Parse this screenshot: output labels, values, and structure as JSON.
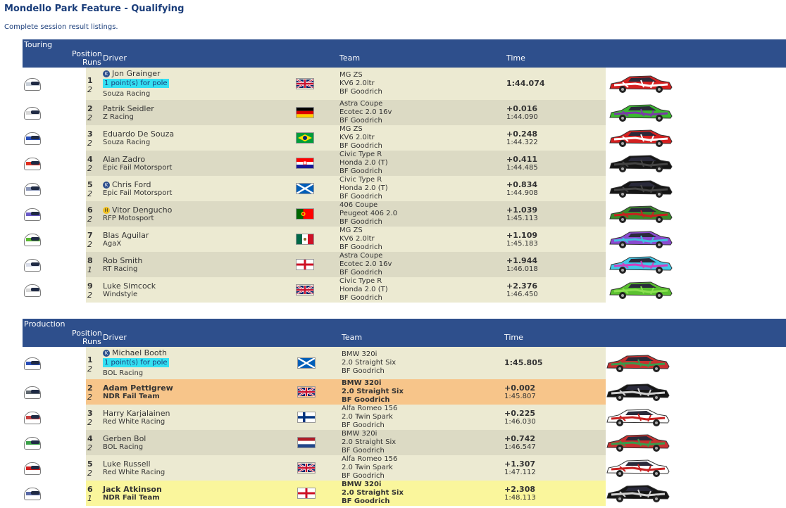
{
  "page": {
    "title": "Mondello Park Feature - Qualifying",
    "subtitle": "Complete session result listings."
  },
  "sections": [
    {
      "name": "Touring",
      "header": {
        "position": "Position",
        "runs": "Runs",
        "driver": "Driver",
        "team": "Team",
        "time": "Time"
      },
      "rows": [
        {
          "pos": "1",
          "runs": "2",
          "badge": "K",
          "driver": "Jon Grainger",
          "pole": "1 point(s) for pole",
          "team": "Souza Racing",
          "flag": "uk",
          "car": [
            "MG ZS",
            "KV6 2.0ltr",
            "BF Goodrich"
          ],
          "time_main": "1:44.074",
          "time_sub": "",
          "helmet": "#c8cfd8",
          "livery": "#d42020",
          "livery2": "#ffffff"
        },
        {
          "pos": "2",
          "runs": "2",
          "badge": "",
          "driver": "Patrik Seidler",
          "pole": "",
          "team": "Z Racing",
          "flag": "germany",
          "car": [
            "Astra Coupe",
            "Ecotec 2.0 16v",
            "BF Goodrich"
          ],
          "time_main": "+0.016",
          "time_sub": "1:44.090",
          "helmet": "#d8d8d8",
          "livery": "#3bb830",
          "livery2": "#7a3aa8"
        },
        {
          "pos": "3",
          "runs": "2",
          "badge": "",
          "driver": "Eduardo De Souza",
          "pole": "",
          "team": "Souza Racing",
          "flag": "brazil",
          "car": [
            "MG ZS",
            "KV6 2.0ltr",
            "BF Goodrich"
          ],
          "time_main": "+0.248",
          "time_sub": "1:44.322",
          "helmet": "#2a4fb8",
          "livery": "#d42020",
          "livery2": "#ffffff"
        },
        {
          "pos": "4",
          "runs": "2",
          "badge": "",
          "driver": "Alan Zadro",
          "pole": "",
          "team": "Epic Fail Motorsport",
          "flag": "croatia",
          "car": [
            "Civic Type R",
            "Honda 2.0 (T)",
            "BF Goodrich"
          ],
          "time_main": "+0.411",
          "time_sub": "1:44.485",
          "helmet": "#e03020",
          "livery": "#151515",
          "livery2": "#444444"
        },
        {
          "pos": "5",
          "runs": "2",
          "badge": "K",
          "driver": "Chris Ford",
          "pole": "",
          "team": "Epic Fail Motorsport",
          "flag": "scotland",
          "car": [
            "Civic Type R",
            "Honda 2.0 (T)",
            "BF Goodrich"
          ],
          "time_main": "+0.834",
          "time_sub": "1:44.908",
          "helmet": "#8a96b8",
          "livery": "#151515",
          "livery2": "#444444"
        },
        {
          "pos": "6",
          "runs": "2",
          "badge": "H",
          "driver": "Vitor Dengucho",
          "pole": "",
          "team": "RFP Motosport",
          "flag": "portugal",
          "car": [
            "406 Coupe",
            "Peugeot 406 2.0",
            "BF Goodrich"
          ],
          "time_main": "+1.039",
          "time_sub": "1:45.113",
          "helmet": "#6a5ac8",
          "livery": "#3a8a2a",
          "livery2": "#c82020"
        },
        {
          "pos": "7",
          "runs": "2",
          "badge": "",
          "driver": "Blas Aguilar",
          "pole": "",
          "team": "AgaX",
          "flag": "mexico",
          "car": [
            "MG ZS",
            "KV6 2.0ltr",
            "BF Goodrich"
          ],
          "time_main": "+1.109",
          "time_sub": "1:45.183",
          "helmet": "#5ab830",
          "livery": "#8a4ad0",
          "livery2": "#40c0e0"
        },
        {
          "pos": "8",
          "runs": "1",
          "badge": "",
          "driver": "Rob Smith",
          "pole": "",
          "team": "RT Racing",
          "flag": "england",
          "car": [
            "Astra Coupe",
            "Ecotec 2.0 16v",
            "BF Goodrich"
          ],
          "time_main": "+1.944",
          "time_sub": "1:46.018",
          "helmet": "#d8dce8",
          "livery": "#40c8e8",
          "livery2": "#d040c0"
        },
        {
          "pos": "9",
          "runs": "2",
          "badge": "",
          "driver": "Luke Simcock",
          "pole": "",
          "team": "Windstyle",
          "flag": "uk",
          "car": [
            "Civic Type R",
            "Honda 2.0 (T)",
            "BF Goodrich"
          ],
          "time_main": "+2.376",
          "time_sub": "1:46.450",
          "helmet": "#d8d8d8",
          "livery": "#5ac030",
          "livery2": "#8ae050"
        }
      ]
    },
    {
      "name": "Production",
      "header": {
        "position": "Position",
        "runs": "Runs",
        "driver": "Driver",
        "team": "Team",
        "time": "Time"
      },
      "rows": [
        {
          "pos": "1",
          "runs": "2",
          "badge": "K",
          "driver": "Michael Booth",
          "pole": "1 point(s) for pole",
          "team": "BOL Racing",
          "flag": "scotland",
          "car": [
            "BMW 320i",
            "2.0 Straight Six",
            "BF Goodrich"
          ],
          "time_main": "1:45.805",
          "time_sub": "",
          "helmet": "#2a4fb8",
          "livery": "#c83030",
          "livery2": "#3a9a4a"
        },
        {
          "pos": "2",
          "runs": "2",
          "badge": "",
          "driver": "Adam Pettigrew",
          "pole": "",
          "team": "NDR Fail Team",
          "flag": "uk",
          "car": [
            "BMW 320i",
            "2.0 Straight Six",
            "BF Goodrich"
          ],
          "time_main": "+0.002",
          "time_sub": "1:45.807",
          "helmet": "#606870",
          "livery": "#151515",
          "livery2": "#d0d0d0"
        },
        {
          "pos": "3",
          "runs": "2",
          "badge": "",
          "driver": "Harry Karjalainen",
          "pole": "",
          "team": "Red White Racing",
          "flag": "finland",
          "car": [
            "Alfa Romeo 156",
            "2.0 Twin Spark",
            "BF Goodrich"
          ],
          "time_main": "+0.225",
          "time_sub": "1:46.030",
          "helmet": "#c84040",
          "livery": "#ffffff",
          "livery2": "#c82020"
        },
        {
          "pos": "4",
          "runs": "2",
          "badge": "",
          "driver": "Gerben Bol",
          "pole": "",
          "team": "BOL Racing",
          "flag": "netherlands",
          "car": [
            "BMW 320i",
            "2.0 Straight Six",
            "BF Goodrich"
          ],
          "time_main": "+0.742",
          "time_sub": "1:46.547",
          "helmet": "#3aa048",
          "livery": "#c83030",
          "livery2": "#3a9a4a"
        },
        {
          "pos": "5",
          "runs": "2",
          "badge": "",
          "driver": "Luke Russell",
          "pole": "",
          "team": "Red White Racing",
          "flag": "uk",
          "car": [
            "Alfa Romeo 156",
            "2.0 Twin Spark",
            "BF Goodrich"
          ],
          "time_main": "+1.307",
          "time_sub": "1:47.112",
          "helmet": "#d02020",
          "livery": "#ffffff",
          "livery2": "#c82020"
        },
        {
          "pos": "6",
          "runs": "1",
          "badge": "",
          "driver": "Jack Atkinson",
          "pole": "",
          "team": "NDR Fail Team",
          "flag": "england",
          "car": [
            "BMW 320i",
            "2.0 Straight Six",
            "BF Goodrich"
          ],
          "time_main": "+2.308",
          "time_sub": "1:48.113",
          "helmet": "#5a6aa8",
          "livery": "#151515",
          "livery2": "#d0d0d0"
        }
      ]
    }
  ]
}
